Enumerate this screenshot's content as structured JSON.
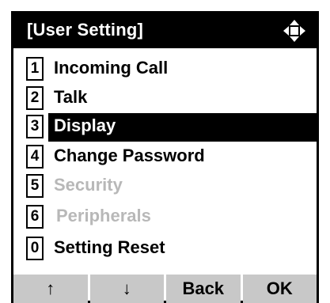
{
  "header": {
    "title": "[User Setting]",
    "nav_icon": "four-way-navigation-icon"
  },
  "menu": {
    "items": [
      {
        "number": "1",
        "label": "Incoming Call",
        "enabled": true,
        "selected": false
      },
      {
        "number": "2",
        "label": "Talk",
        "enabled": true,
        "selected": false
      },
      {
        "number": "3",
        "label": "Display",
        "enabled": true,
        "selected": true
      },
      {
        "number": "4",
        "label": "Change Password",
        "enabled": true,
        "selected": false
      },
      {
        "number": "5",
        "label": "Security",
        "enabled": false,
        "selected": false
      },
      {
        "number": "6",
        "label": "Peripherals",
        "enabled": false,
        "selected": false
      },
      {
        "number": "0",
        "label": "Setting Reset",
        "enabled": true,
        "selected": false
      }
    ]
  },
  "softkeys": {
    "up": "↑",
    "down": "↓",
    "back": "Back",
    "ok": "OK"
  },
  "colors": {
    "header_bg": "#000000",
    "selected_bg": "#000000",
    "disabled_text": "#b8b8b8",
    "softkey_bg": "#c8c8c8"
  }
}
